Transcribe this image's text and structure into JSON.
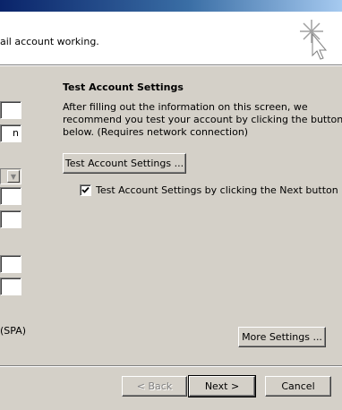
{
  "header": {
    "description": "ail account working."
  },
  "fields": {
    "field1_value": "",
    "field2_value": "n",
    "field4_value": "",
    "field5_value": "",
    "field6_value": "",
    "field7_value": ""
  },
  "spa_label": "(SPA)",
  "test_section": {
    "title": "Test Account Settings",
    "description_lines": [
      "After filling out the information on this screen, we",
      "recommend you test your account by clicking the button",
      "below. (Requires network connection)"
    ],
    "test_button_label": "Test Account Settings ...",
    "checkbox_label": "Test Account Settings by clicking the Next button",
    "checkbox_checked": true
  },
  "more_settings_label": "More Settings ...",
  "footer": {
    "back_label": "< Back",
    "next_label": "Next >",
    "cancel_label": "Cancel"
  },
  "icons": {
    "wizard": "wizard-cursor-sparkle-icon",
    "checkmark": "checkmark-icon",
    "dropdown": "chevron-down-icon"
  },
  "colors": {
    "dialog_bg": "#d4d0c8",
    "titlebar_start": "#0a246a",
    "titlebar_end": "#a6caf0",
    "disabled_text": "#808080"
  }
}
